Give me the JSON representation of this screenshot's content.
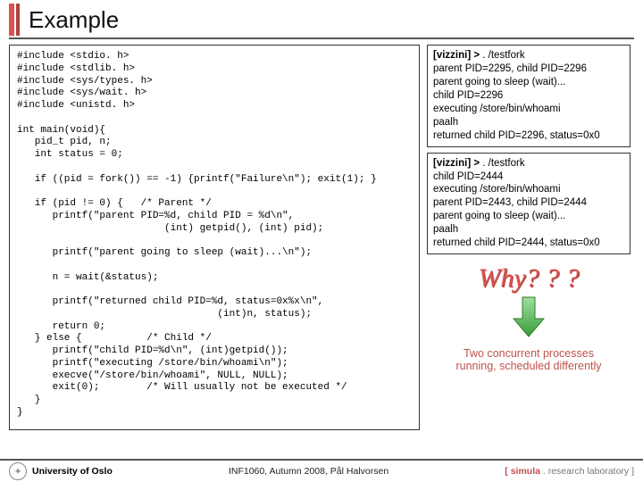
{
  "title": "Example",
  "code": "#include <stdio. h>\n#include <stdlib. h>\n#include <sys/types. h>\n#include <sys/wait. h>\n#include <unistd. h>\n\nint main(void){\n   pid_t pid, n;\n   int status = 0;\n\n   if ((pid = fork()) == -1) {printf(\"Failure\\n\"); exit(1); }\n\n   if (pid != 0) {   /* Parent */\n      printf(\"parent PID=%d, child PID = %d\\n\",\n                         (int) getpid(), (int) pid);\n\n      printf(\"parent going to sleep (wait)...\\n\");\n\n      n = wait(&status);\n\n      printf(\"returned child PID=%d, status=0x%x\\n\",\n                                  (int)n, status);\n      return 0;\n   } else {           /* Child */\n      printf(\"child PID=%d\\n\", (int)getpid());\n      printf(\"executing /store/bin/whoami\\n\");\n      execve(\"/store/bin/whoami\", NULL, NULL);\n      exit(0);        /* Will usually not be executed */\n   }\n}",
  "out1": {
    "prompt": "[vizzini] >",
    "cmd": ". /testfork",
    "l1": "parent PID=2295, child PID=2296",
    "l2": "parent going to sleep (wait)...",
    "l3": "child PID=2296",
    "l4": "executing /store/bin/whoami",
    "l5": "paalh",
    "l6": "returned child PID=2296, status=0x0"
  },
  "out2": {
    "prompt": "[vizzini] >",
    "cmd": ". /testfork",
    "l1": "child PID=2444",
    "l2": "executing /store/bin/whoami",
    "l3": "parent PID=2443, child PID=2444",
    "l4": "parent going to sleep (wait)...",
    "l5": "paalh",
    "l6": "returned child PID=2444, status=0x0"
  },
  "why": "Why? ? ?",
  "caption1": "Two concurrent processes",
  "caption2": "running, scheduled differently",
  "footer": {
    "uni": "University of Oslo",
    "mid": "INF1060, Autumn 2008, Pål Halvorsen",
    "sim_open": "[ ",
    "sim_brand": "simula",
    "sim_rest": " . research laboratory ]"
  }
}
